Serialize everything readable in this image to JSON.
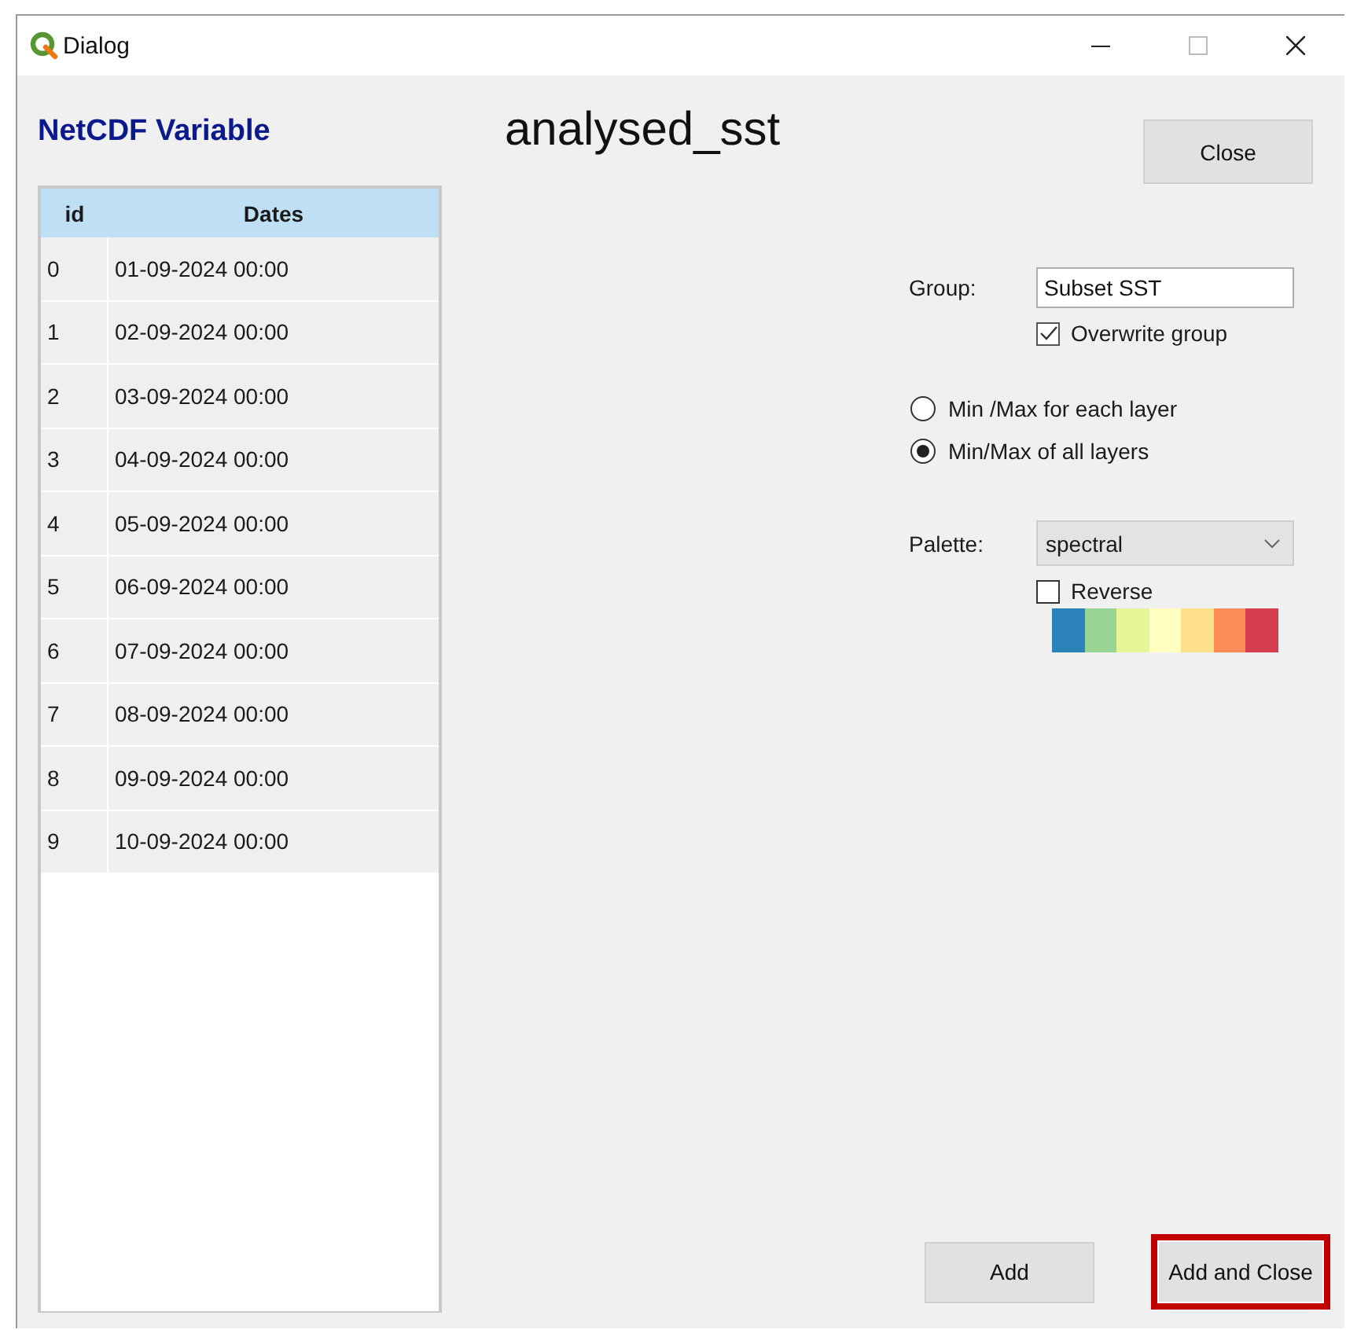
{
  "window": {
    "title": "Dialog"
  },
  "header": {
    "section_title": "NetCDF Variable",
    "variable": "analysed_sst"
  },
  "table": {
    "columns": [
      "id",
      "Dates"
    ],
    "rows": [
      [
        "0",
        "01-09-2024 00:00"
      ],
      [
        "1",
        "02-09-2024 00:00"
      ],
      [
        "2",
        "03-09-2024 00:00"
      ],
      [
        "3",
        "04-09-2024 00:00"
      ],
      [
        "4",
        "05-09-2024 00:00"
      ],
      [
        "5",
        "06-09-2024 00:00"
      ],
      [
        "6",
        "07-09-2024 00:00"
      ],
      [
        "7",
        "08-09-2024 00:00"
      ],
      [
        "8",
        "09-09-2024 00:00"
      ],
      [
        "9",
        "10-09-2024 00:00"
      ]
    ]
  },
  "close_button": {
    "label": "Close"
  },
  "group": {
    "label": "Group:",
    "value": "Subset SST",
    "overwrite": {
      "label": "Overwrite group",
      "checked": true
    }
  },
  "range_options": [
    {
      "label": "Min /Max for each layer",
      "selected": false
    },
    {
      "label": "Min/Max of all layers",
      "selected": true
    }
  ],
  "palette": {
    "label": "Palette:",
    "value": "spectral",
    "reverse": {
      "label": "Reverse",
      "checked": false
    },
    "colors": [
      {
        "color": "#2b83ba"
      },
      {
        "color": "#99d594"
      },
      {
        "color": "#e6f598"
      },
      {
        "color": "#ffffbf"
      },
      {
        "color": "#fee08b"
      },
      {
        "color": "#fc8d59"
      },
      {
        "color": "#d53e4f"
      }
    ]
  },
  "buttons": [
    {
      "label": "Add",
      "highlighted": false
    },
    {
      "label": "Add and Close",
      "highlighted": true
    }
  ]
}
